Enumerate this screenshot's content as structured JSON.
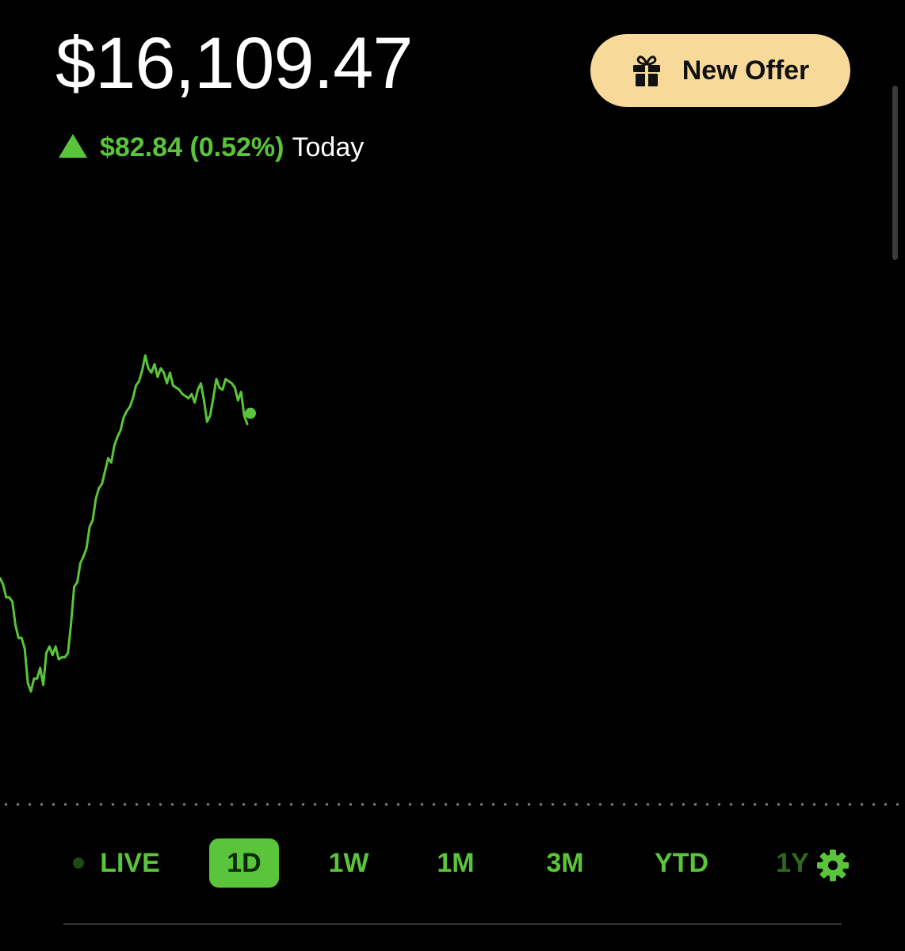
{
  "portfolio": {
    "balance": "$16,109.47",
    "change_amount": "$82.84 (0.52%)",
    "change_period": "Today"
  },
  "offer_button": {
    "label": "New Offer",
    "icon": "gift-icon"
  },
  "chart_data": {
    "type": "line",
    "title": "",
    "xlabel": "",
    "ylabel": "",
    "x": [
      0,
      1,
      2,
      3,
      4,
      5,
      6,
      7,
      8,
      9,
      10,
      11,
      12,
      13,
      14,
      15,
      16,
      17,
      18,
      19,
      20,
      21,
      22,
      23,
      24,
      25,
      26,
      27,
      28,
      29,
      30,
      31,
      32,
      33,
      34,
      35,
      36,
      37,
      38,
      39,
      40,
      41,
      42,
      43,
      44,
      45,
      46,
      47,
      48,
      49,
      50,
      51,
      52,
      53,
      54,
      55,
      56,
      57,
      58,
      59,
      60,
      61,
      62,
      63,
      64,
      65,
      66,
      67,
      68,
      69,
      70,
      71,
      72,
      73,
      74,
      75,
      76,
      77,
      78,
      79,
      80
    ],
    "values": [
      16068,
      16065,
      16059,
      16059,
      16057,
      16046,
      16040,
      16040,
      16035,
      16019,
      16015,
      16021,
      16021,
      16026,
      16018,
      16033,
      16036,
      16032,
      16036,
      16030,
      16031,
      16031,
      16033,
      16047,
      16064,
      16066,
      16075,
      16078,
      16082,
      16092,
      16095,
      16105,
      16110,
      16112,
      16118,
      16124,
      16122,
      16130,
      16134,
      16137,
      16143,
      16146,
      16148,
      16152,
      16158,
      16160,
      16165,
      16172,
      16166,
      16164,
      16168,
      16162,
      16166,
      16164,
      16159,
      16164,
      16158,
      16157,
      16156,
      16154,
      16153,
      16152,
      16154,
      16150,
      16156,
      16159,
      16151,
      16141,
      16144,
      16152,
      16161,
      16157,
      16156,
      16161,
      16160,
      16159,
      16157,
      16151,
      16155,
      16144,
      16140
    ],
    "last_point_value": 16140,
    "ylim": [
      15990,
      16190
    ],
    "line_color": "#5ac53b",
    "grid": false,
    "legend": "none"
  },
  "time_ranges": [
    {
      "label": "LIVE",
      "active": false
    },
    {
      "label": "1D",
      "active": true
    },
    {
      "label": "1W",
      "active": false
    },
    {
      "label": "1M",
      "active": false
    },
    {
      "label": "3M",
      "active": false
    },
    {
      "label": "YTD",
      "active": false
    },
    {
      "label": "1Y",
      "active": false
    }
  ],
  "settings": {
    "icon": "gear-icon"
  },
  "colors": {
    "background": "#000000",
    "accent_green": "#5ac53b",
    "offer_bg": "#f7d999",
    "text_primary": "#ffffff"
  }
}
